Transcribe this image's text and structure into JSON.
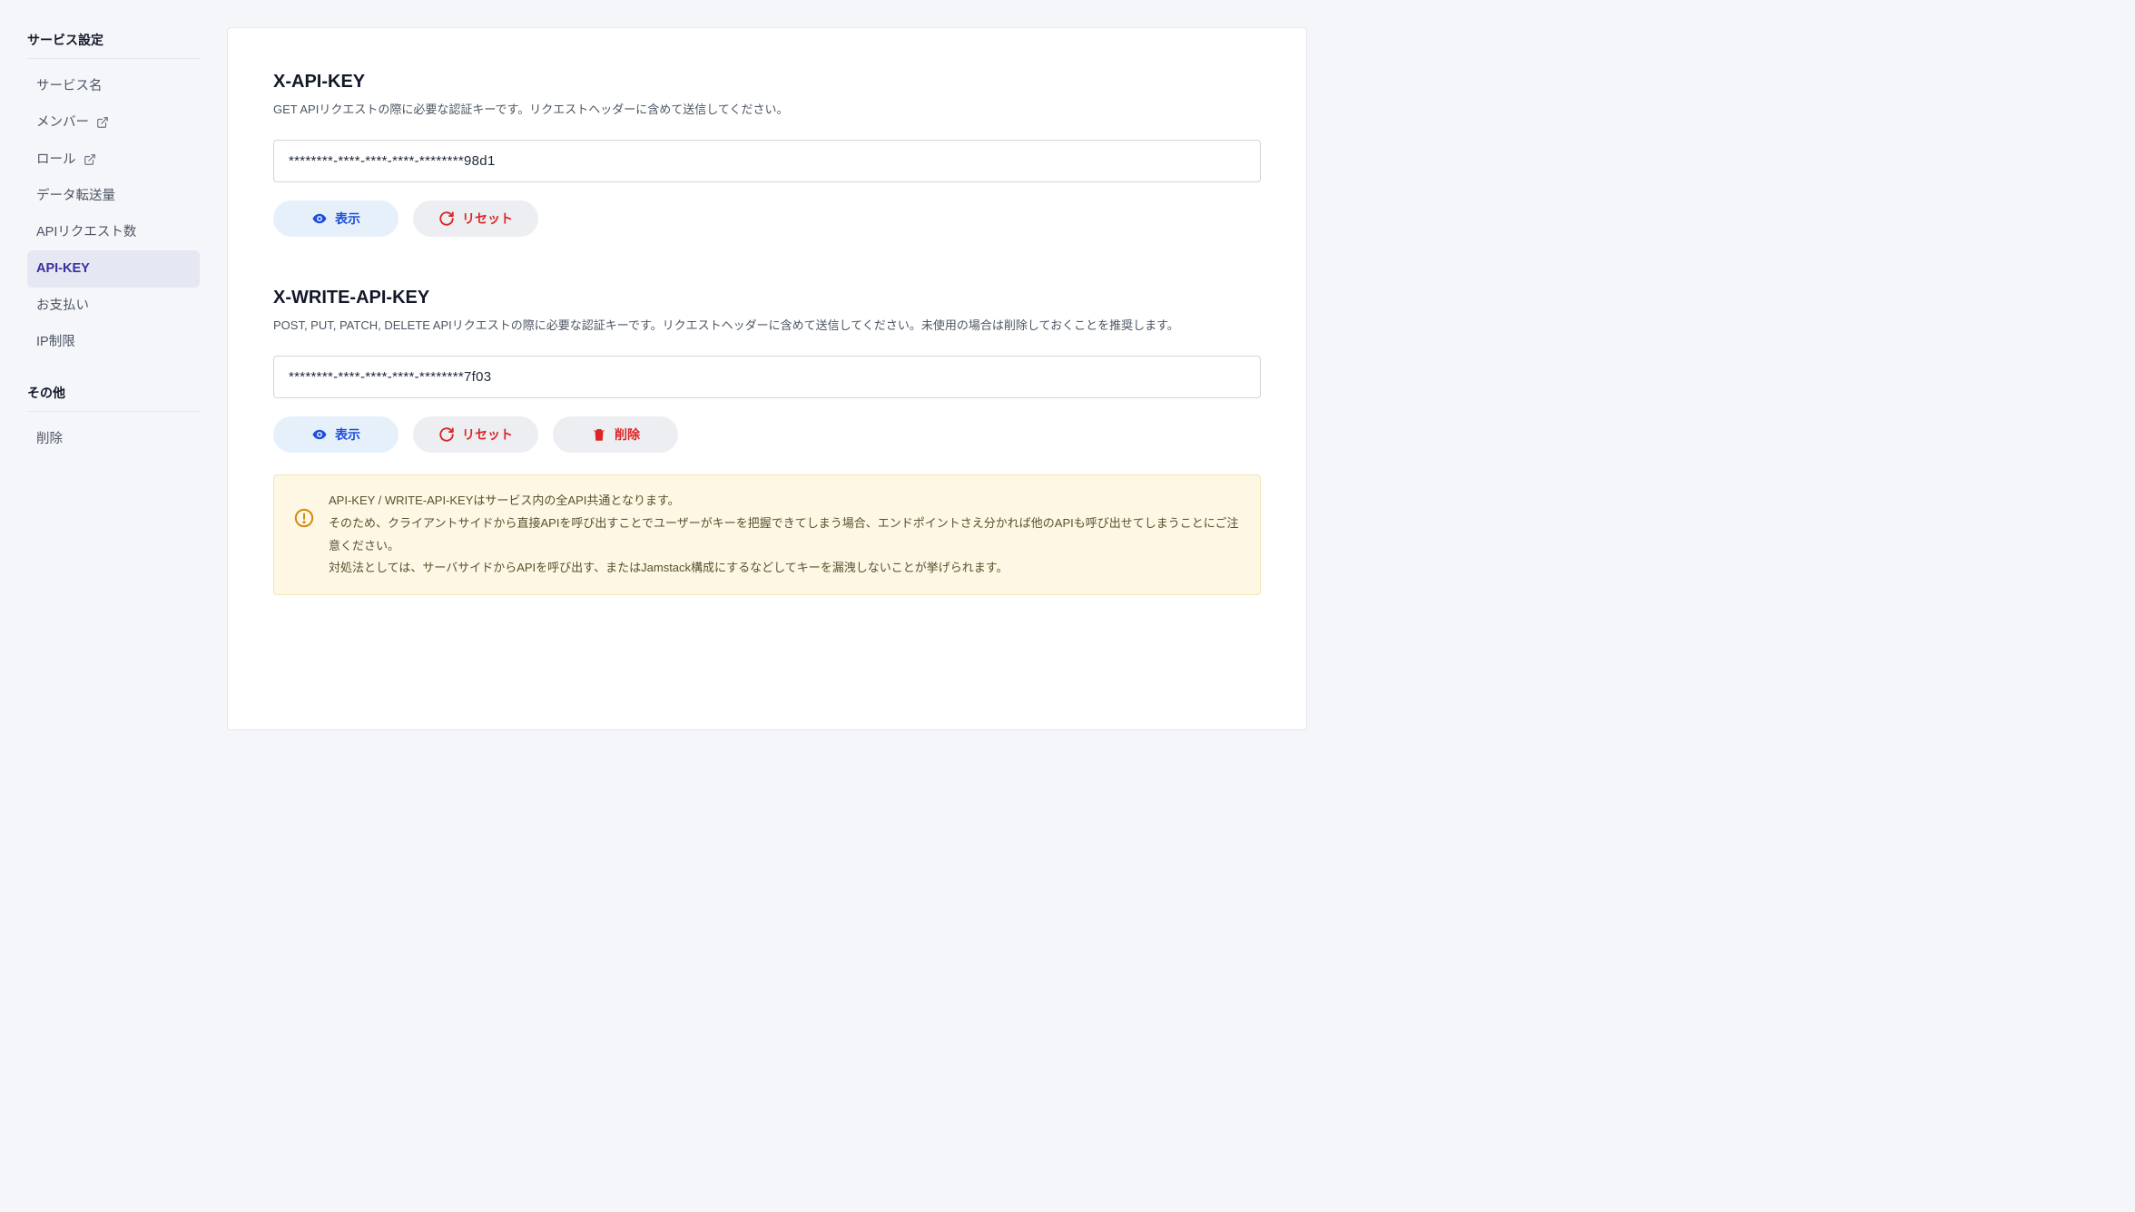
{
  "sidebar": {
    "group1_title": "サービス設定",
    "items1": [
      {
        "label": "サービス名",
        "external": false,
        "active": false
      },
      {
        "label": "メンバー",
        "external": true,
        "active": false
      },
      {
        "label": "ロール",
        "external": true,
        "active": false
      },
      {
        "label": "データ転送量",
        "external": false,
        "active": false
      },
      {
        "label": "APIリクエスト数",
        "external": false,
        "active": false
      },
      {
        "label": "API-KEY",
        "external": false,
        "active": true
      },
      {
        "label": "お支払い",
        "external": false,
        "active": false
      },
      {
        "label": "IP制限",
        "external": false,
        "active": false
      }
    ],
    "group2_title": "その他",
    "items2": [
      {
        "label": "削除",
        "external": false,
        "active": false
      }
    ]
  },
  "section_api_key": {
    "title": "X-API-KEY",
    "desc": "GET APIリクエストの際に必要な認証キーです。リクエストヘッダーに含めて送信してください。",
    "value": "********-****-****-****-********98d1",
    "btn_show": "表示",
    "btn_reset": "リセット"
  },
  "section_write_key": {
    "title": "X-WRITE-API-KEY",
    "desc": "POST, PUT, PATCH, DELETE APIリクエストの際に必要な認証キーです。リクエストヘッダーに含めて送信してください。未使用の場合は削除しておくことを推奨します。",
    "value": "********-****-****-****-********7f03",
    "btn_show": "表示",
    "btn_reset": "リセット",
    "btn_delete": "削除"
  },
  "warning": {
    "line1": "API-KEY / WRITE-API-KEYはサービス内の全API共通となります。",
    "line2": "そのため、クライアントサイドから直接APIを呼び出すことでユーザーがキーを把握できてしまう場合、エンドポイントさえ分かれば他のAPIも呼び出せてしまうことにご注意ください。",
    "line3": "対処法としては、サーバサイドからAPIを呼び出す、またはJamstack構成にするなどしてキーを漏洩しないことが挙げられます。"
  }
}
